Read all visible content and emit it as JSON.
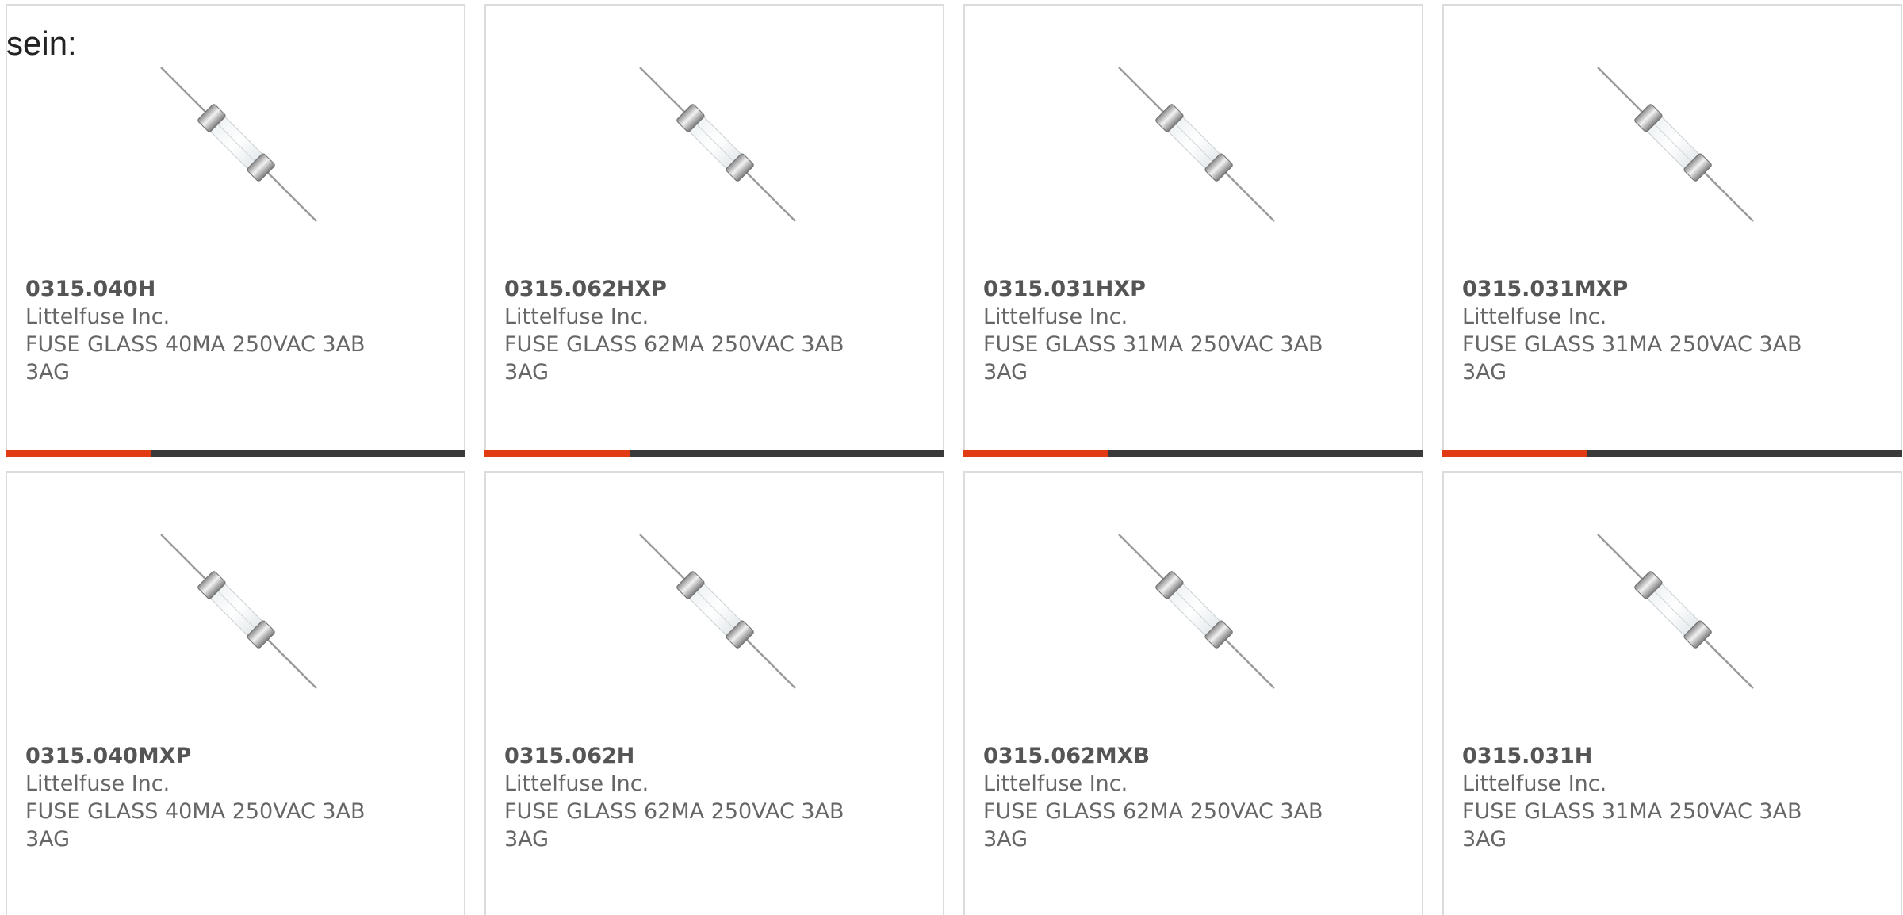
{
  "intro_text": "sein:",
  "colors": {
    "accent": "#e23a12",
    "bar": "#3a3a3a",
    "border": "#dcdcdc",
    "text": "#666666"
  },
  "product_image_icon": "glass-fuse-icon",
  "products": [
    {
      "part_number": "0315.040H",
      "manufacturer": "Littelfuse Inc.",
      "description": "FUSE GLASS 40MA 250VAC 3AB 3AG"
    },
    {
      "part_number": "0315.062HXP",
      "manufacturer": "Littelfuse Inc.",
      "description": "FUSE GLASS 62MA 250VAC 3AB 3AG"
    },
    {
      "part_number": "0315.031HXP",
      "manufacturer": "Littelfuse Inc.",
      "description": "FUSE GLASS 31MA 250VAC 3AB 3AG"
    },
    {
      "part_number": "0315.031MXP",
      "manufacturer": "Littelfuse Inc.",
      "description": "FUSE GLASS 31MA 250VAC 3AB 3AG"
    },
    {
      "part_number": "0315.040MXP",
      "manufacturer": "Littelfuse Inc.",
      "description": "FUSE GLASS 40MA 250VAC 3AB 3AG"
    },
    {
      "part_number": "0315.062H",
      "manufacturer": "Littelfuse Inc.",
      "description": "FUSE GLASS 62MA 250VAC 3AB 3AG"
    },
    {
      "part_number": "0315.062MXB",
      "manufacturer": "Littelfuse Inc.",
      "description": "FUSE GLASS 62MA 250VAC 3AB 3AG"
    },
    {
      "part_number": "0315.031H",
      "manufacturer": "Littelfuse Inc.",
      "description": "FUSE GLASS 31MA 250VAC 3AB 3AG"
    }
  ]
}
